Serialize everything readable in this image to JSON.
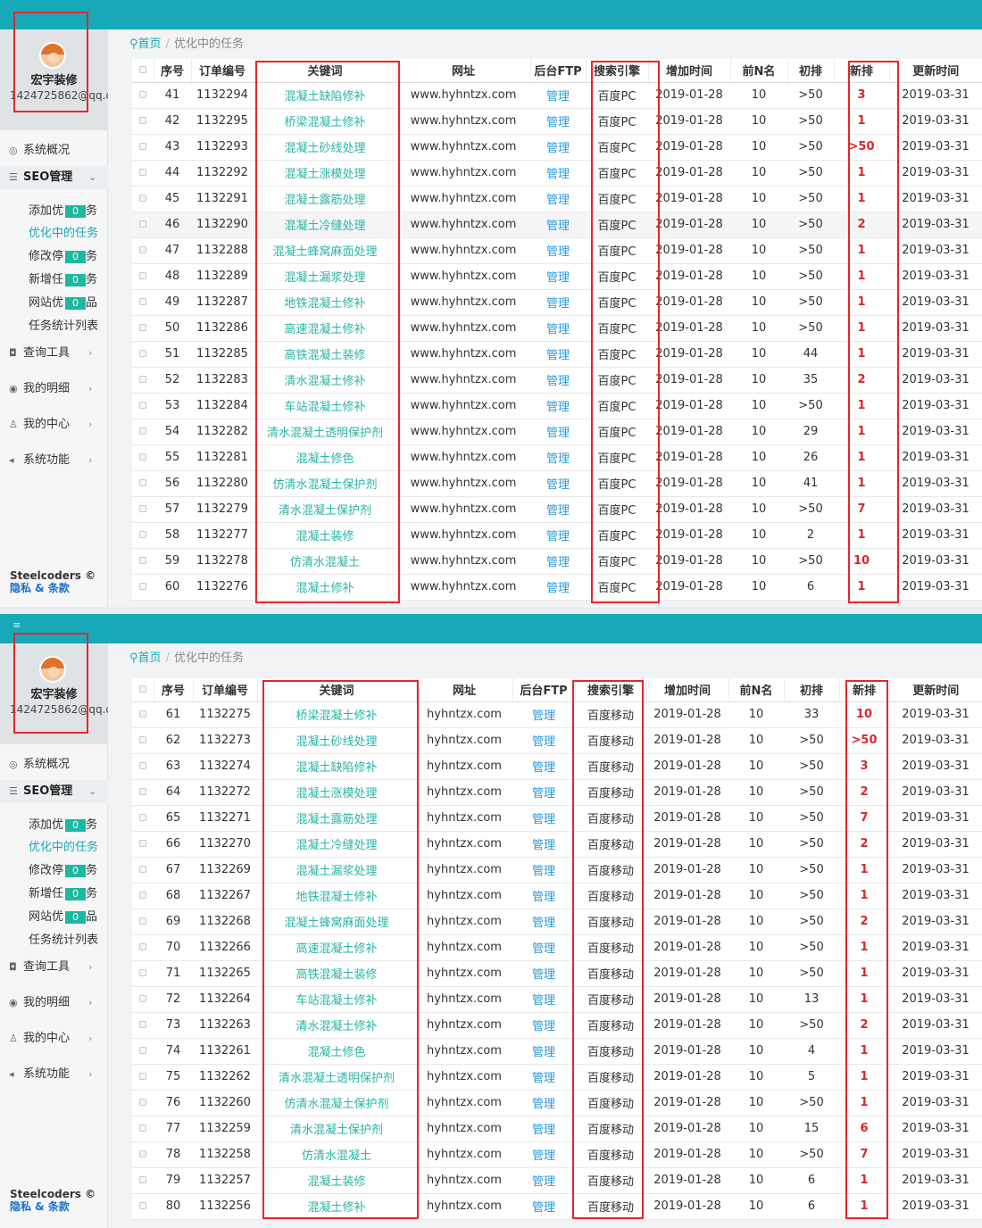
{
  "colors": {
    "topbar": "#17a9b8",
    "accent": "#17a9b8",
    "keyword": "#2ab3a6",
    "link": "#2a9ad8",
    "highlight_red": "#e5262b",
    "badge": "#1db8a0"
  },
  "panels": [
    {
      "user": {
        "name": "宏宇装修",
        "email": "1424725862@qq.c"
      },
      "nav": {
        "overview": "系统概况",
        "seo": "SEO管理",
        "sub": [
          {
            "label": "添加优",
            "count": "0",
            "tail": "务"
          },
          {
            "label": "优化中的任务"
          },
          {
            "label": "修改停",
            "count": "0",
            "tail": "务"
          },
          {
            "label": "新增任",
            "count": "0",
            "tail": "务"
          },
          {
            "label": "网站优",
            "count": "0",
            "tail": "品"
          },
          {
            "label": "任务统计列表"
          }
        ],
        "query": "查询工具",
        "detail": "我的明细",
        "center": "我的中心",
        "system": "系统功能"
      },
      "footer": {
        "brand": "Steelcoders ©",
        "links": "隐私 & 条款"
      },
      "breadcrumb": {
        "home": "首页",
        "current": "优化中的任务"
      },
      "table": {
        "headers": [
          "序号",
          "订单编号",
          "关键词",
          "网址",
          "后台FTP",
          "搜索引擎",
          "增加时间",
          "前N名",
          "初排",
          "新排",
          "更新时间"
        ],
        "rows": [
          [
            "41",
            "1132294",
            "混凝土缺陷修补",
            "www.hyhntzx.com",
            "管理",
            "百度PC",
            "2019-01-28",
            "10",
            ">50",
            "3",
            "2019-03-31"
          ],
          [
            "42",
            "1132295",
            "桥梁混凝土修补",
            "www.hyhntzx.com",
            "管理",
            "百度PC",
            "2019-01-28",
            "10",
            ">50",
            "1",
            "2019-03-31"
          ],
          [
            "43",
            "1132293",
            "混凝土砂线处理",
            "www.hyhntzx.com",
            "管理",
            "百度PC",
            "2019-01-28",
            "10",
            ">50",
            ">50",
            "2019-03-31"
          ],
          [
            "44",
            "1132292",
            "混凝土涨模处理",
            "www.hyhntzx.com",
            "管理",
            "百度PC",
            "2019-01-28",
            "10",
            ">50",
            "1",
            "2019-03-31"
          ],
          [
            "45",
            "1132291",
            "混凝土露筋处理",
            "www.hyhntzx.com",
            "管理",
            "百度PC",
            "2019-01-28",
            "10",
            ">50",
            "1",
            "2019-03-31"
          ],
          [
            "46",
            "1132290",
            "混凝土冷缝处理",
            "www.hyhntzx.com",
            "管理",
            "百度PC",
            "2019-01-28",
            "10",
            ">50",
            "2",
            "2019-03-31"
          ],
          [
            "47",
            "1132288",
            "混凝土蜂窝麻面处理",
            "www.hyhntzx.com",
            "管理",
            "百度PC",
            "2019-01-28",
            "10",
            ">50",
            "1",
            "2019-03-31"
          ],
          [
            "48",
            "1132289",
            "混凝土漏浆处理",
            "www.hyhntzx.com",
            "管理",
            "百度PC",
            "2019-01-28",
            "10",
            ">50",
            "1",
            "2019-03-31"
          ],
          [
            "49",
            "1132287",
            "地铁混凝土修补",
            "www.hyhntzx.com",
            "管理",
            "百度PC",
            "2019-01-28",
            "10",
            ">50",
            "1",
            "2019-03-31"
          ],
          [
            "50",
            "1132286",
            "高速混凝土修补",
            "www.hyhntzx.com",
            "管理",
            "百度PC",
            "2019-01-28",
            "10",
            ">50",
            "1",
            "2019-03-31"
          ],
          [
            "51",
            "1132285",
            "高铁混凝土装修",
            "www.hyhntzx.com",
            "管理",
            "百度PC",
            "2019-01-28",
            "10",
            "44",
            "1",
            "2019-03-31"
          ],
          [
            "52",
            "1132283",
            "清水混凝土修补",
            "www.hyhntzx.com",
            "管理",
            "百度PC",
            "2019-01-28",
            "10",
            "35",
            "2",
            "2019-03-31"
          ],
          [
            "53",
            "1132284",
            "车站混凝土修补",
            "www.hyhntzx.com",
            "管理",
            "百度PC",
            "2019-01-28",
            "10",
            ">50",
            "1",
            "2019-03-31"
          ],
          [
            "54",
            "1132282",
            "清水混凝土透明保护剂",
            "www.hyhntzx.com",
            "管理",
            "百度PC",
            "2019-01-28",
            "10",
            "29",
            "1",
            "2019-03-31"
          ],
          [
            "55",
            "1132281",
            "混凝土修色",
            "www.hyhntzx.com",
            "管理",
            "百度PC",
            "2019-01-28",
            "10",
            "26",
            "1",
            "2019-03-31"
          ],
          [
            "56",
            "1132280",
            "仿清水混凝土保护剂",
            "www.hyhntzx.com",
            "管理",
            "百度PC",
            "2019-01-28",
            "10",
            "41",
            "1",
            "2019-03-31"
          ],
          [
            "57",
            "1132279",
            "清水混凝土保护剂",
            "www.hyhntzx.com",
            "管理",
            "百度PC",
            "2019-01-28",
            "10",
            ">50",
            "7",
            "2019-03-31"
          ],
          [
            "58",
            "1132277",
            "混凝土装修",
            "www.hyhntzx.com",
            "管理",
            "百度PC",
            "2019-01-28",
            "10",
            "2",
            "1",
            "2019-03-31"
          ],
          [
            "59",
            "1132278",
            "仿清水混凝土",
            "www.hyhntzx.com",
            "管理",
            "百度PC",
            "2019-01-28",
            "10",
            ">50",
            "10",
            "2019-03-31"
          ],
          [
            "60",
            "1132276",
            "混凝土修补",
            "www.hyhntzx.com",
            "管理",
            "百度PC",
            "2019-01-28",
            "10",
            "6",
            "1",
            "2019-03-31"
          ]
        ]
      }
    },
    {
      "user": {
        "name": "宏宇装修",
        "email": "1424725862@qq.c"
      },
      "nav": {
        "overview": "系统概况",
        "seo": "SEO管理",
        "sub": [
          {
            "label": "添加优",
            "count": "0",
            "tail": "务"
          },
          {
            "label": "优化中的任务"
          },
          {
            "label": "修改停",
            "count": "0",
            "tail": "务"
          },
          {
            "label": "新增任",
            "count": "0",
            "tail": "务"
          },
          {
            "label": "网站优",
            "count": "0",
            "tail": "品"
          },
          {
            "label": "任务统计列表"
          }
        ],
        "query": "查询工具",
        "detail": "我的明细",
        "center": "我的中心",
        "system": "系统功能"
      },
      "footer": {
        "brand": "Steelcoders ©",
        "links": "隐私 & 条款"
      },
      "breadcrumb": {
        "home": "首页",
        "current": "优化中的任务"
      },
      "table": {
        "headers": [
          "序号",
          "订单编号",
          "关键词",
          "网址",
          "后台FTP",
          "搜索引擎",
          "增加时间",
          "前N名",
          "初排",
          "新排",
          "更新时间"
        ],
        "rows": [
          [
            "61",
            "1132275",
            "桥梁混凝土修补",
            "hyhntzx.com",
            "管理",
            "百度移动",
            "2019-01-28",
            "10",
            "33",
            "10",
            "2019-03-31"
          ],
          [
            "62",
            "1132273",
            "混凝土砂线处理",
            "hyhntzx.com",
            "管理",
            "百度移动",
            "2019-01-28",
            "10",
            ">50",
            ">50",
            "2019-03-31"
          ],
          [
            "63",
            "1132274",
            "混凝土缺陷修补",
            "hyhntzx.com",
            "管理",
            "百度移动",
            "2019-01-28",
            "10",
            ">50",
            "3",
            "2019-03-31"
          ],
          [
            "64",
            "1132272",
            "混凝土涨模处理",
            "hyhntzx.com",
            "管理",
            "百度移动",
            "2019-01-28",
            "10",
            ">50",
            "2",
            "2019-03-31"
          ],
          [
            "65",
            "1132271",
            "混凝土露筋处理",
            "hyhntzx.com",
            "管理",
            "百度移动",
            "2019-01-28",
            "10",
            ">50",
            "7",
            "2019-03-31"
          ],
          [
            "66",
            "1132270",
            "混凝土冷缝处理",
            "hyhntzx.com",
            "管理",
            "百度移动",
            "2019-01-28",
            "10",
            ">50",
            "2",
            "2019-03-31"
          ],
          [
            "67",
            "1132269",
            "混凝土漏浆处理",
            "hyhntzx.com",
            "管理",
            "百度移动",
            "2019-01-28",
            "10",
            ">50",
            "1",
            "2019-03-31"
          ],
          [
            "68",
            "1132267",
            "地铁混凝土修补",
            "hyhntzx.com",
            "管理",
            "百度移动",
            "2019-01-28",
            "10",
            ">50",
            "1",
            "2019-03-31"
          ],
          [
            "69",
            "1132268",
            "混凝土蜂窝麻面处理",
            "hyhntzx.com",
            "管理",
            "百度移动",
            "2019-01-28",
            "10",
            ">50",
            "2",
            "2019-03-31"
          ],
          [
            "70",
            "1132266",
            "高速混凝土修补",
            "hyhntzx.com",
            "管理",
            "百度移动",
            "2019-01-28",
            "10",
            ">50",
            "1",
            "2019-03-31"
          ],
          [
            "71",
            "1132265",
            "高铁混凝土装修",
            "hyhntzx.com",
            "管理",
            "百度移动",
            "2019-01-28",
            "10",
            ">50",
            "1",
            "2019-03-31"
          ],
          [
            "72",
            "1132264",
            "车站混凝土修补",
            "hyhntzx.com",
            "管理",
            "百度移动",
            "2019-01-28",
            "10",
            "13",
            "1",
            "2019-03-31"
          ],
          [
            "73",
            "1132263",
            "清水混凝土修补",
            "hyhntzx.com",
            "管理",
            "百度移动",
            "2019-01-28",
            "10",
            ">50",
            "2",
            "2019-03-31"
          ],
          [
            "74",
            "1132261",
            "混凝土修色",
            "hyhntzx.com",
            "管理",
            "百度移动",
            "2019-01-28",
            "10",
            "4",
            "1",
            "2019-03-31"
          ],
          [
            "75",
            "1132262",
            "清水混凝土透明保护剂",
            "hyhntzx.com",
            "管理",
            "百度移动",
            "2019-01-28",
            "10",
            "5",
            "1",
            "2019-03-31"
          ],
          [
            "76",
            "1132260",
            "仿清水混凝土保护剂",
            "hyhntzx.com",
            "管理",
            "百度移动",
            "2019-01-28",
            "10",
            ">50",
            "1",
            "2019-03-31"
          ],
          [
            "77",
            "1132259",
            "清水混凝土保护剂",
            "hyhntzx.com",
            "管理",
            "百度移动",
            "2019-01-28",
            "10",
            "15",
            "6",
            "2019-03-31"
          ],
          [
            "78",
            "1132258",
            "仿清水混凝土",
            "hyhntzx.com",
            "管理",
            "百度移动",
            "2019-01-28",
            "10",
            ">50",
            "7",
            "2019-03-31"
          ],
          [
            "79",
            "1132257",
            "混凝土装修",
            "hyhntzx.com",
            "管理",
            "百度移动",
            "2019-01-28",
            "10",
            "6",
            "1",
            "2019-03-31"
          ],
          [
            "80",
            "1132256",
            "混凝土修补",
            "hyhntzx.com",
            "管理",
            "百度移动",
            "2019-01-28",
            "10",
            "6",
            "1",
            "2019-03-31"
          ]
        ]
      }
    }
  ]
}
